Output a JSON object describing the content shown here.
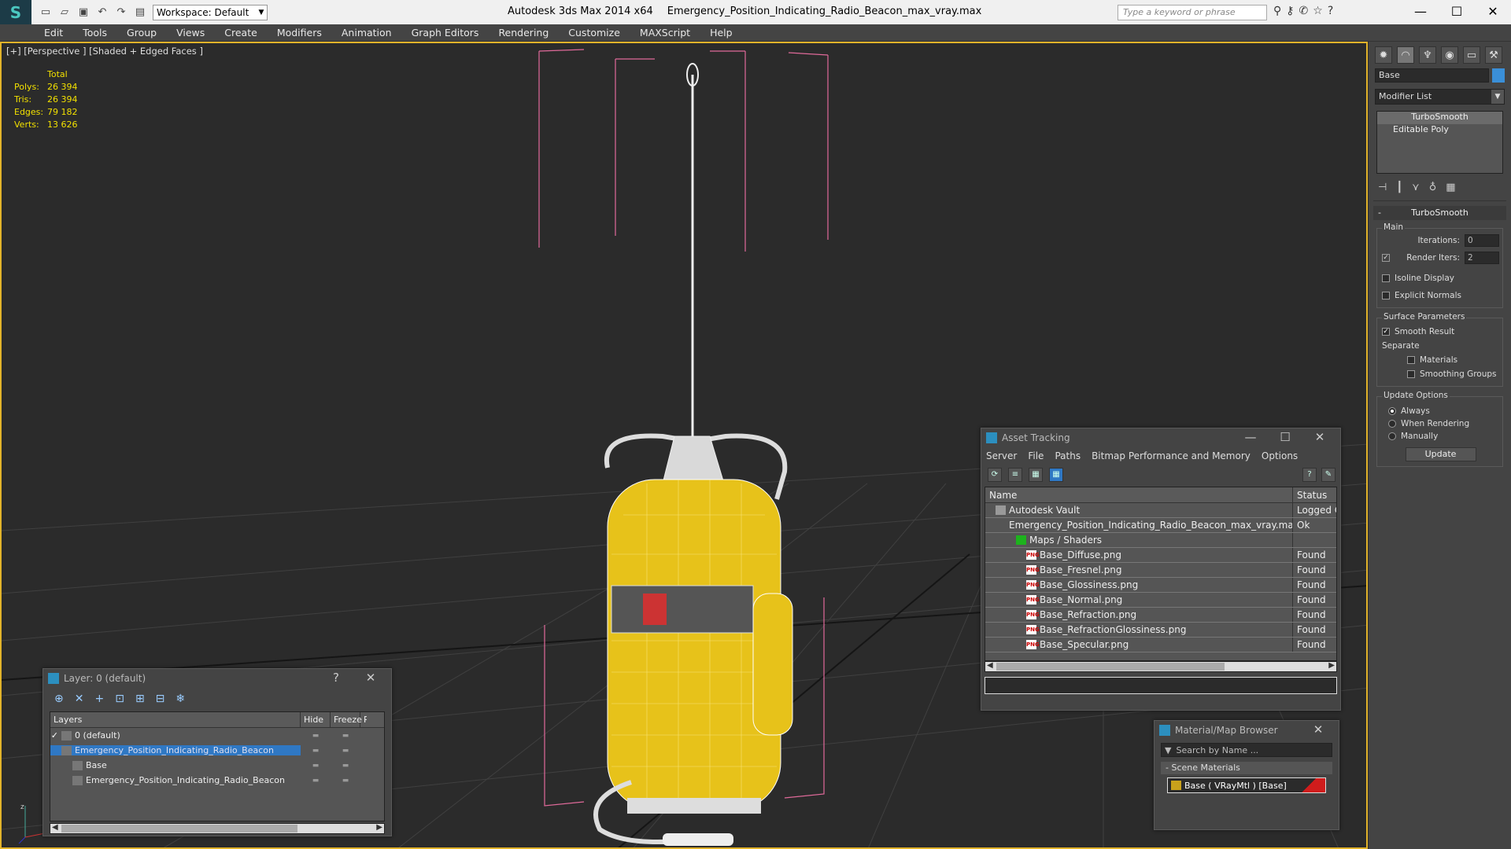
{
  "app": {
    "product": "Autodesk 3ds Max  2014 x64",
    "file": "Emergency_Position_Indicating_Radio_Beacon_max_vray.max",
    "workspace": "Workspace: Default",
    "search_placeholder": "Type a keyword or phrase"
  },
  "menu": [
    "Edit",
    "Tools",
    "Group",
    "Views",
    "Create",
    "Modifiers",
    "Animation",
    "Graph Editors",
    "Rendering",
    "Customize",
    "MAXScript",
    "Help"
  ],
  "viewport": {
    "label": "[+] [Perspective ] [Shaded + Edged Faces ]",
    "stats_header": "Total",
    "stats": [
      {
        "k": "Polys:",
        "v": "26 394"
      },
      {
        "k": "Tris:",
        "v": "26 394"
      },
      {
        "k": "Edges:",
        "v": "79 182"
      },
      {
        "k": "Verts:",
        "v": "13 626"
      }
    ]
  },
  "command_panel": {
    "object_name": "Base",
    "modifier_list": "Modifier List",
    "stack": [
      "TurboSmooth",
      "Editable Poly"
    ],
    "rollout_title": "TurboSmooth",
    "main_group": "Main",
    "iterations_label": "Iterations:",
    "iterations_value": "0",
    "render_iters_label": "Render Iters:",
    "render_iters_value": "2",
    "isoline": "Isoline Display",
    "explicit": "Explicit Normals",
    "surface_group": "Surface Parameters",
    "smooth_result": "Smooth Result",
    "separate": "Separate",
    "materials": "Materials",
    "smoothing_groups": "Smoothing Groups",
    "update_group": "Update Options",
    "always": "Always",
    "when_rendering": "When Rendering",
    "manually": "Manually",
    "update_btn": "Update"
  },
  "asset_tracking": {
    "title": "Asset Tracking",
    "menu": [
      "Server",
      "File",
      "Paths",
      "Bitmap Performance and Memory",
      "Options"
    ],
    "col_name": "Name",
    "col_status": "Status",
    "rows": [
      {
        "name": "Autodesk Vault",
        "status": "Logged O",
        "indent": 1,
        "icon": "vault"
      },
      {
        "name": "Emergency_Position_Indicating_Radio_Beacon_max_vray.max",
        "status": "Ok",
        "indent": 2,
        "icon": "max"
      },
      {
        "name": "Maps / Shaders",
        "status": "",
        "indent": 3,
        "icon": "fld"
      },
      {
        "name": "Base_Diffuse.png",
        "status": "Found",
        "indent": 4,
        "icon": "png"
      },
      {
        "name": "Base_Fresnel.png",
        "status": "Found",
        "indent": 4,
        "icon": "png"
      },
      {
        "name": "Base_Glossiness.png",
        "status": "Found",
        "indent": 4,
        "icon": "png"
      },
      {
        "name": "Base_Normal.png",
        "status": "Found",
        "indent": 4,
        "icon": "png"
      },
      {
        "name": "Base_Refraction.png",
        "status": "Found",
        "indent": 4,
        "icon": "png"
      },
      {
        "name": "Base_RefractionGlossiness.png",
        "status": "Found",
        "indent": 4,
        "icon": "png"
      },
      {
        "name": "Base_Specular.png",
        "status": "Found",
        "indent": 4,
        "icon": "png"
      }
    ]
  },
  "layer_explorer": {
    "title": "Layer: 0 (default)",
    "col_layers": "Layers",
    "col_hide": "Hide",
    "col_freeze": "Freeze",
    "col_r": "R",
    "rows": [
      {
        "name": "0 (default)",
        "indent": 1,
        "sel": false
      },
      {
        "name": "Emergency_Position_Indicating_Radio_Beacon",
        "indent": 1,
        "sel": true
      },
      {
        "name": "Base",
        "indent": 2,
        "sel": false
      },
      {
        "name": "Emergency_Position_Indicating_Radio_Beacon",
        "indent": 2,
        "sel": false
      }
    ]
  },
  "material_browser": {
    "title": "Material/Map Browser",
    "search_placeholder": "Search by Name ...",
    "group": "- Scene Materials",
    "item": "Base  ( VRayMtl )  [Base]"
  },
  "colors": {
    "accent": "#2f78c4",
    "viewport_border": "#e2b32a",
    "stats": "#f2e000",
    "model_yellow": "#e7c21a"
  }
}
